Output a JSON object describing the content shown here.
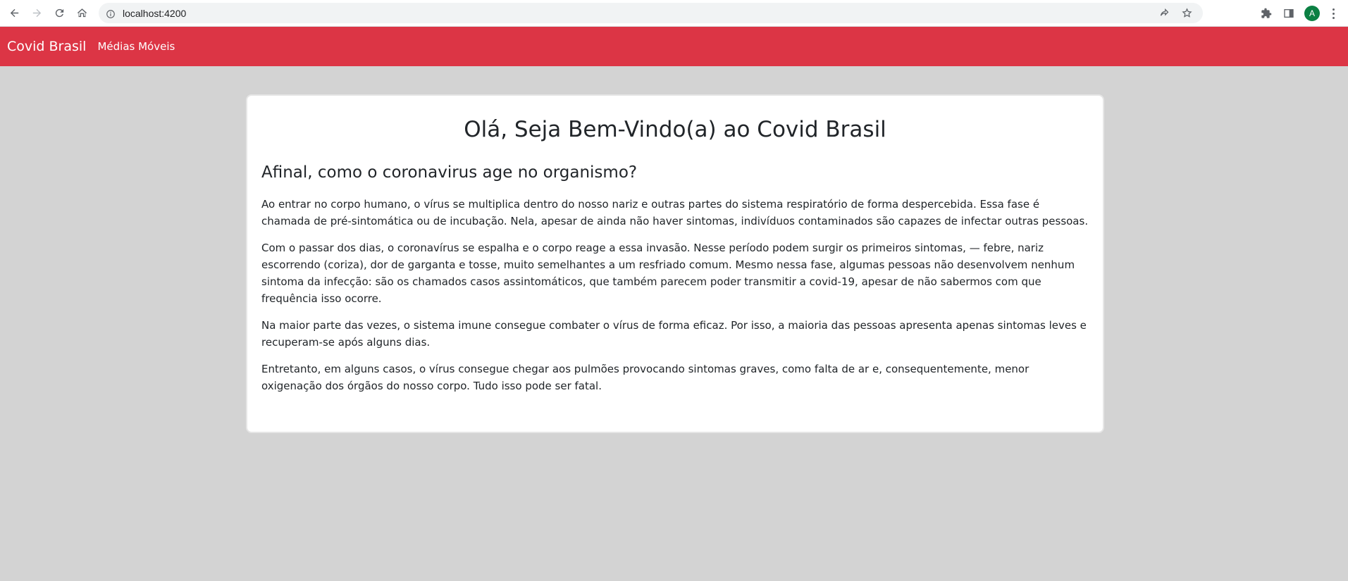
{
  "browser": {
    "url": "localhost:4200",
    "avatar_letter": "A"
  },
  "navbar": {
    "brand": "Covid Brasil",
    "links": [
      "Médias Móveis"
    ],
    "color": "#dc3545"
  },
  "card": {
    "title": "Olá, Seja Bem-Vindo(a) ao Covid Brasil",
    "subtitle": "Afinal, como o coronavirus age no organismo?",
    "paragraphs": [
      "Ao entrar no corpo humano, o vírus se multiplica dentro do nosso nariz e outras partes do sistema respiratório de forma despercebida. Essa fase é chamada de pré-sintomática ou de incubação. Nela, apesar de ainda não haver sintomas, indivíduos contaminados são capazes de infectar outras pessoas.",
      "Com o passar dos dias, o coronavírus se espalha e o corpo reage a essa invasão. Nesse período podem surgir os primeiros sintomas, — febre, nariz escorrendo (coriza), dor de garganta e tosse, muito semelhantes a um resfriado comum. Mesmo nessa fase, algumas pessoas não desenvolvem nenhum sintoma da infecção: são os chamados casos assintomáticos, que também parecem poder transmitir a covid-19, apesar de não sabermos com que frequência isso ocorre.",
      "Na maior parte das vezes, o sistema imune consegue combater o vírus de forma eficaz. Por isso, a maioria das pessoas apresenta apenas sintomas leves e recuperam-se após alguns dias.",
      "Entretanto, em alguns casos, o vírus consegue chegar aos pulmões provocando sintomas graves, como falta de ar e, consequentemente, menor oxigenação dos órgãos do nosso corpo. Tudo isso pode ser fatal."
    ]
  }
}
